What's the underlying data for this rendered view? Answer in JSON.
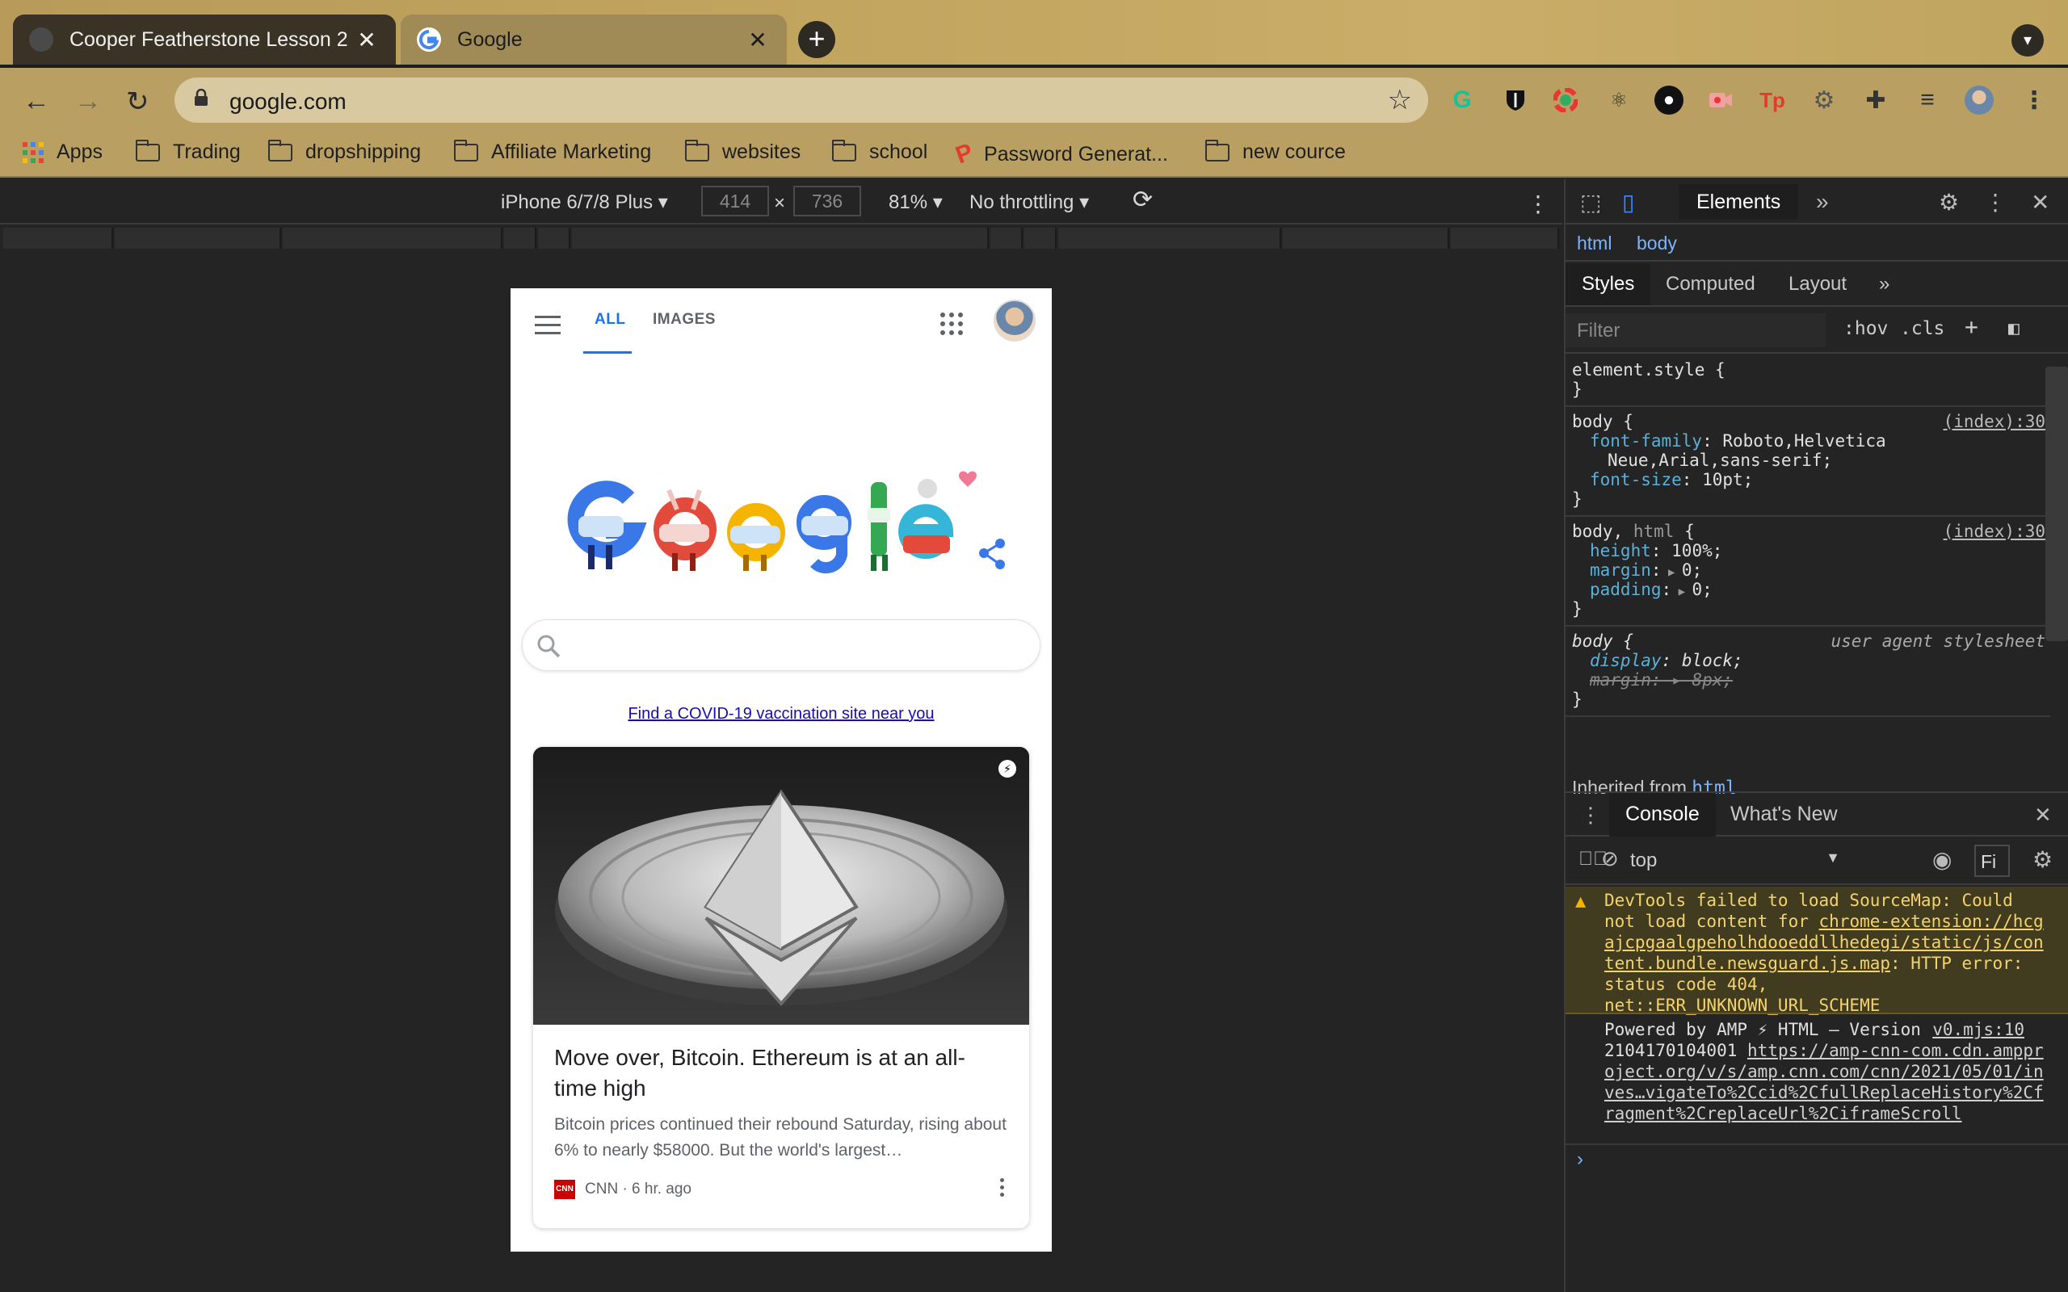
{
  "tabs": [
    {
      "title": "Cooper Featherstone Lesson 2",
      "close": "✕",
      "active": false
    },
    {
      "title": "Google",
      "close": "✕",
      "active": true
    }
  ],
  "new_tab_label": "+",
  "address_bar": {
    "url": "google.com"
  },
  "bookmarks": [
    {
      "label": "Apps",
      "icon": "apps-grid-icon"
    },
    {
      "label": "Trading",
      "icon": "folder-icon"
    },
    {
      "label": "dropshipping",
      "icon": "folder-icon"
    },
    {
      "label": "Affiliate Marketing",
      "icon": "folder-icon"
    },
    {
      "label": "websites",
      "icon": "folder-icon"
    },
    {
      "label": "school",
      "icon": "folder-icon"
    },
    {
      "label": "Password Generat...",
      "icon": "tp-icon"
    },
    {
      "label": "new cource",
      "icon": "folder-icon"
    }
  ],
  "device_toolbar": {
    "device": "iPhone 6/7/8 Plus",
    "width": "414",
    "times": "×",
    "height": "736",
    "zoom": "81%",
    "throttling": "No throttling"
  },
  "google_page": {
    "tab_all": "ALL",
    "tab_images": "IMAGES",
    "search_placeholder": "",
    "covid_link": "Find a COVID-19 vaccination site near you",
    "card": {
      "title": "Move over, Bitcoin. Ethereum is at an all-time high",
      "snippet": "Bitcoin prices continued their rebound Saturday, rising about 6% to nearly $58000. But the world's largest…",
      "source_logo": "CNN",
      "source": "CNN · 6 hr. ago"
    }
  },
  "devtools": {
    "main_tab": "Elements",
    "breadcrumbs": [
      "html",
      "body"
    ],
    "subtabs": [
      "Styles",
      "Computed",
      "Layout"
    ],
    "filter_placeholder": "Filter",
    "hov": ":hov",
    "cls": ".cls",
    "rules": {
      "element_style": "element.style {",
      "body_selector": "body",
      "body_source": "(index):30",
      "font_family_prop": "font-family",
      "font_family_val": "Roboto,Helvetica",
      "font_family_val2": "Neue,Arial,sans-serif;",
      "font_size_prop": "font-size",
      "font_size_val": "10pt;",
      "bodyhtml_selector_1": "body",
      "bodyhtml_selector_2": "html",
      "bodyhtml_source": "(index):30",
      "height_prop": "height",
      "height_val": "100%;",
      "margin_prop": "margin",
      "margin_val": "0;",
      "padding_prop": "padding",
      "padding_val": "0;",
      "ua_selector": "body",
      "ua_source": "user agent stylesheet",
      "display_prop": "display",
      "display_val": "block;",
      "ua_margin": "margin: ▸ 8px;"
    },
    "inherited_label": "Inherited from",
    "inherited_from": "html",
    "drawer_tabs": [
      "Console",
      "What's New"
    ],
    "console_context": "top",
    "console_filter": "Fi",
    "warning": {
      "text1": "DevTools failed to load SourceMap: Could not load content for ",
      "link": "chrome-extension://hcgajcpgaalgpeholhdooeddllhedegi/static/js/content.bundle.newsguard.js.map",
      "text2": ": HTTP error: status code 404, net::ERR_UNKNOWN_URL_SCHEME"
    },
    "log": {
      "text": "Powered by AMP ⚡ HTML – Version 2104170104001 ",
      "source": "v0.mjs:10",
      "link": "https://amp-cnn-com.cdn.ampproject.org/v/s/amp.cnn.com/cnn/2021/05/01/inves…vigateTo%2Ccid%2CfullReplaceHistory%2Cfragment%2CreplaceUrl%2CiframeScroll"
    },
    "prompt": "›"
  }
}
